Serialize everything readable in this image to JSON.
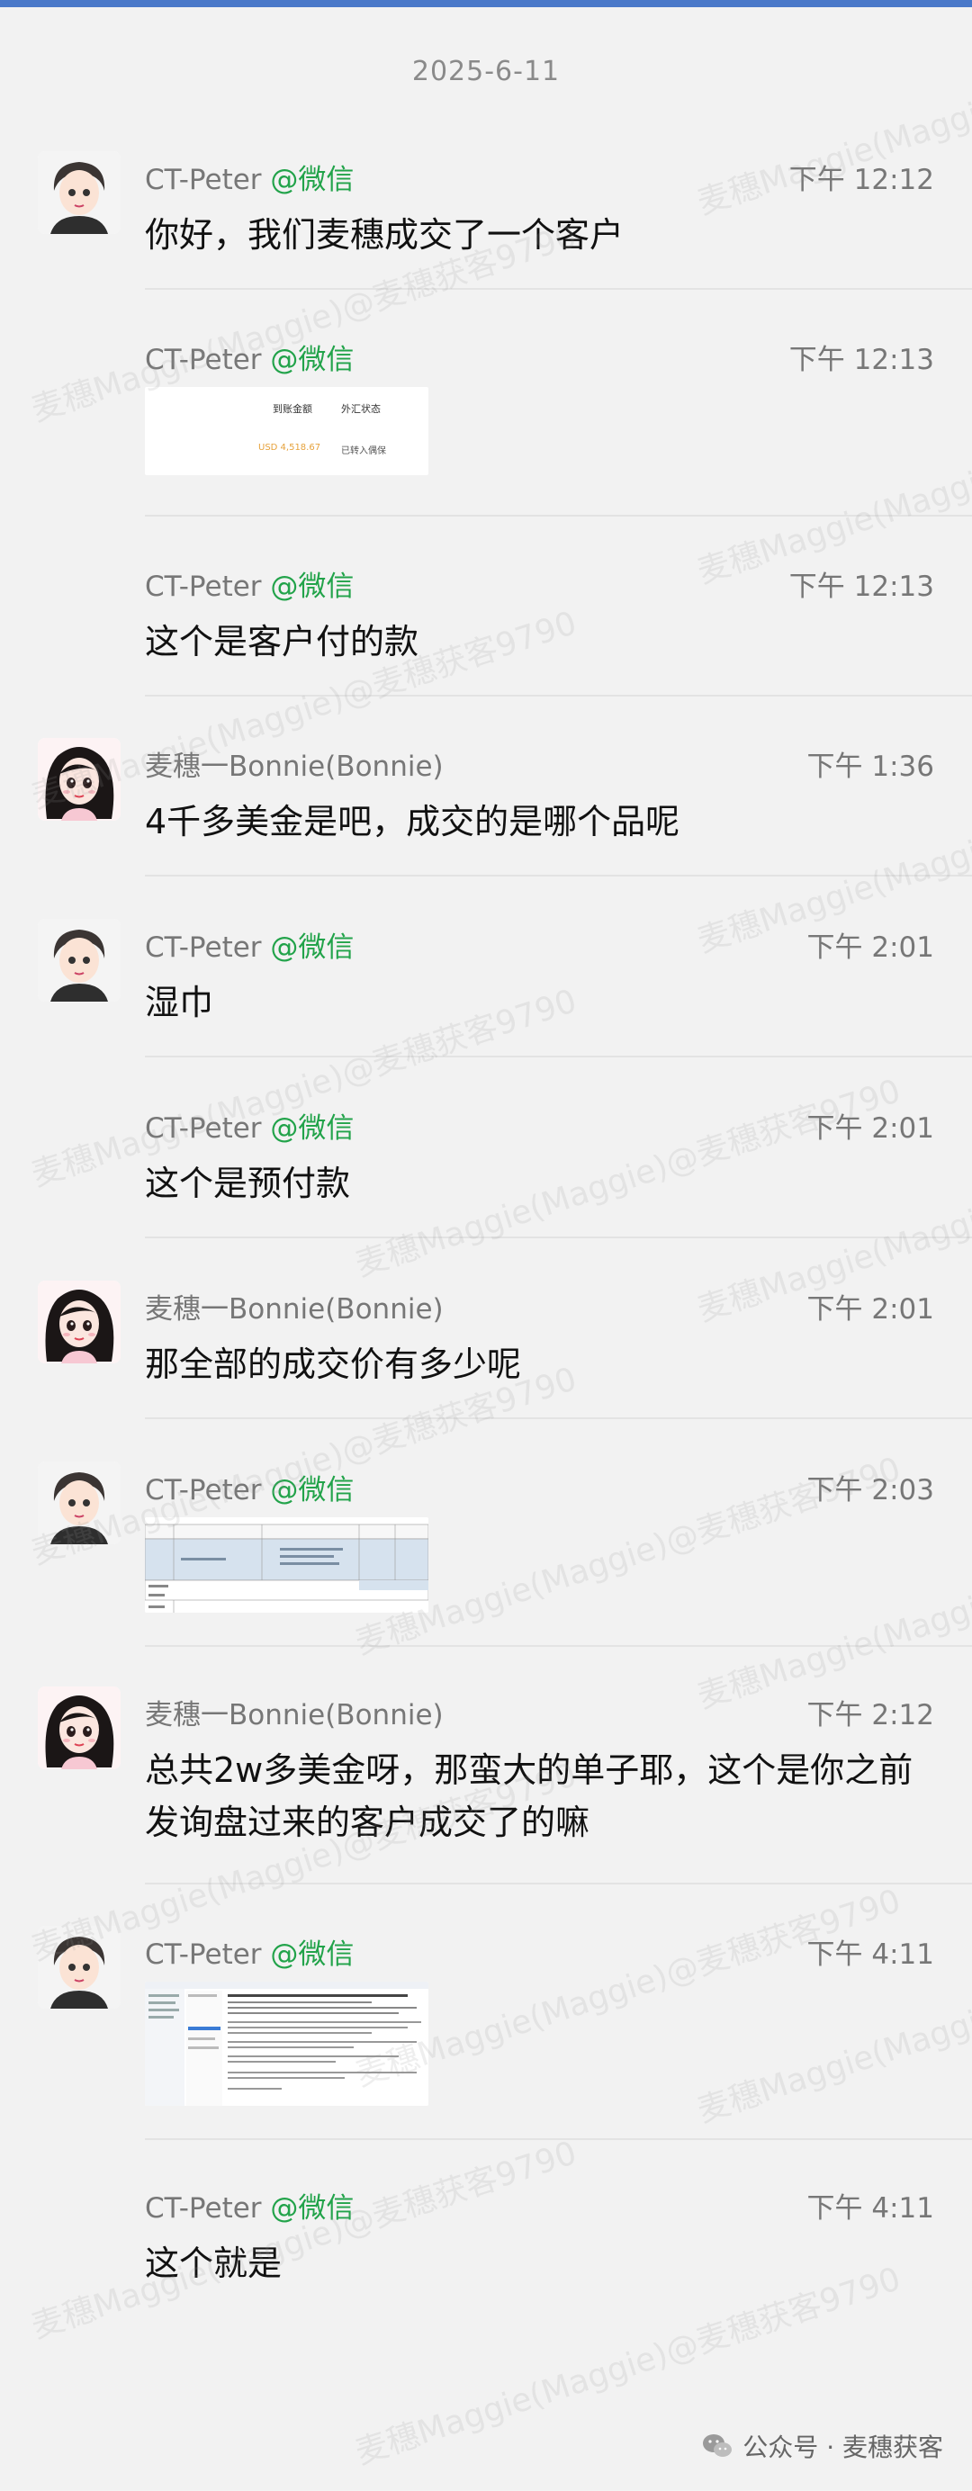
{
  "date": "2025-6-11",
  "watermark": "麦穗Maggie(Maggie)@麦穗获客9790",
  "source_tag": "@微信",
  "messages": [
    {
      "sender": "CT-Peter",
      "time": "下午 12:12",
      "text": "你好，我们麦穗成交了一个客户"
    },
    {
      "sender": "CT-Peter",
      "time": "下午 12:13",
      "image": {
        "col1": "到账金额",
        "col2": "外汇状态",
        "val1": "USD 4,518.67",
        "val2": "已转入偶保"
      }
    },
    {
      "sender": "CT-Peter",
      "time": "下午 12:13",
      "text": "这个是客户付的款"
    },
    {
      "sender": "麦穗一Bonnie(Bonnie)",
      "time": "下午 1:36",
      "text": "4千多美金是吧，成交的是哪个品呢"
    },
    {
      "sender": "CT-Peter",
      "time": "下午 2:01",
      "text": "湿巾"
    },
    {
      "sender": "CT-Peter",
      "time": "下午 2:01",
      "text": "这个是预付款"
    },
    {
      "sender": "麦穗一Bonnie(Bonnie)",
      "time": "下午 2:01",
      "text": "那全部的成交价有多少呢"
    },
    {
      "sender": "CT-Peter",
      "time": "下午 2:03",
      "image": "table-screenshot"
    },
    {
      "sender": "麦穗一Bonnie(Bonnie)",
      "time": "下午 2:12",
      "text": "总共2w多美金呀，那蛮大的单子耶，这个是你之前发询盘过来的客户成交了的嘛"
    },
    {
      "sender": "CT-Peter",
      "time": "下午 4:11",
      "image": "email-screenshot"
    },
    {
      "sender": "CT-Peter",
      "time": "下午 4:11",
      "text": "这个就是"
    }
  ],
  "footer": {
    "text": "公众号 · 麦穗获客"
  },
  "colors": {
    "accent_bar": "#4a79c9",
    "source_green": "#22a34a",
    "background": "#f2f2f2"
  }
}
